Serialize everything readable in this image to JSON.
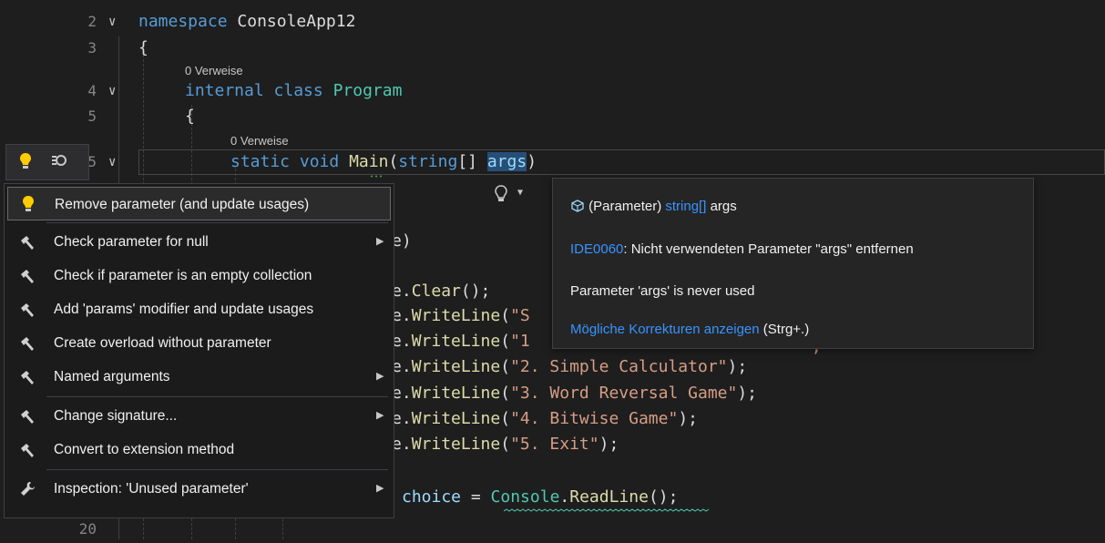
{
  "editor": {
    "lines": [
      {
        "num": "2",
        "fold": "∨"
      },
      {
        "num": "3"
      },
      {
        "num": "4",
        "fold": "∨"
      },
      {
        "num": "5"
      },
      {
        "num": "5",
        "fold": "∨"
      },
      {
        "num": "20"
      }
    ],
    "codelens": [
      "0 Verweise",
      "0 Verweise"
    ],
    "code": {
      "namespace_kw": "namespace",
      "namespace_name": "ConsoleApp12",
      "brace_open": "{",
      "internal_kw": "internal",
      "class_kw": "class",
      "class_name": "Program",
      "static_kw": "static",
      "void_kw": "void",
      "main_name": "Main",
      "paren_open": "(",
      "string_kw": "string",
      "array_brackets": "[]",
      "args_name": "args",
      "paren_close": ")",
      "e_paren": "e)",
      "clear_call": [
        ".",
        "Clear",
        "();"
      ],
      "writeline_lines": [
        {
          "prefix": "e.",
          "fn": "WriteLine",
          "open": "(",
          "str": "\"S"
        },
        {
          "prefix": "e.",
          "fn": "WriteLine",
          "open": "(",
          "str": "\"1"
        },
        {
          "prefix": "e.",
          "fn": "WriteLine",
          "open": "(",
          "str": "\"2. Simple Calculator\"",
          "close": ");"
        },
        {
          "prefix": "e.",
          "fn": "WriteLine",
          "open": "(",
          "str": "\"3. Word Reversal Game\"",
          "close": ");"
        },
        {
          "prefix": "e.",
          "fn": "WriteLine",
          "open": "(",
          "str": "\"4. Bitwise Game\"",
          "close": ");"
        },
        {
          "prefix": "e.",
          "fn": "WriteLine",
          "open": "(",
          "str": "\"5. Exit\"",
          "close": ");"
        }
      ],
      "choice_var": "choice",
      "equals": " = ",
      "console_type": "Console",
      "readline": "ReadLine",
      "readline_close": "();",
      "e_prefix": "e",
      "partial_tail_a": ");",
      "partial_tail_b": "”,"
    }
  },
  "quick_actions": {
    "items": [
      {
        "label": "Remove parameter (and update usages)",
        "icon": "lightbulb-icon"
      },
      {
        "label": "Check parameter for null",
        "icon": "hammer-icon",
        "submenu": true
      },
      {
        "label": "Check if parameter is an empty collection",
        "icon": "hammer-icon"
      },
      {
        "label": "Add 'params' modifier and update usages",
        "icon": "hammer-icon"
      },
      {
        "label": "Create overload without parameter",
        "icon": "hammer-icon"
      },
      {
        "label": "Named arguments",
        "icon": "hammer-icon",
        "submenu": true
      },
      {
        "label": "Change signature...",
        "icon": "hammer-icon",
        "submenu": true
      },
      {
        "label": "Convert to extension method",
        "icon": "hammer-icon"
      },
      {
        "label": "Inspection: 'Unused parameter'",
        "icon": "wrench-icon",
        "submenu": true
      }
    ]
  },
  "tooltip": {
    "param_prefix": "(Parameter)",
    "param_type": "string[]",
    "param_name": "args",
    "diagnostic_code": "IDE0060",
    "diagnostic_text": ": Nicht verwendeten Parameter \"args\" entfernen",
    "message": "Parameter 'args' is never used",
    "fix_link": "Mögliche Korrekturen anzeigen",
    "fix_shortcut": "(Strg+.)"
  },
  "colors": {
    "keyword": "#569cd6",
    "type": "#4ec9b0",
    "method": "#dcdcaa",
    "string": "#d69d85",
    "link": "#3794ff",
    "background": "#1e1e1e"
  }
}
